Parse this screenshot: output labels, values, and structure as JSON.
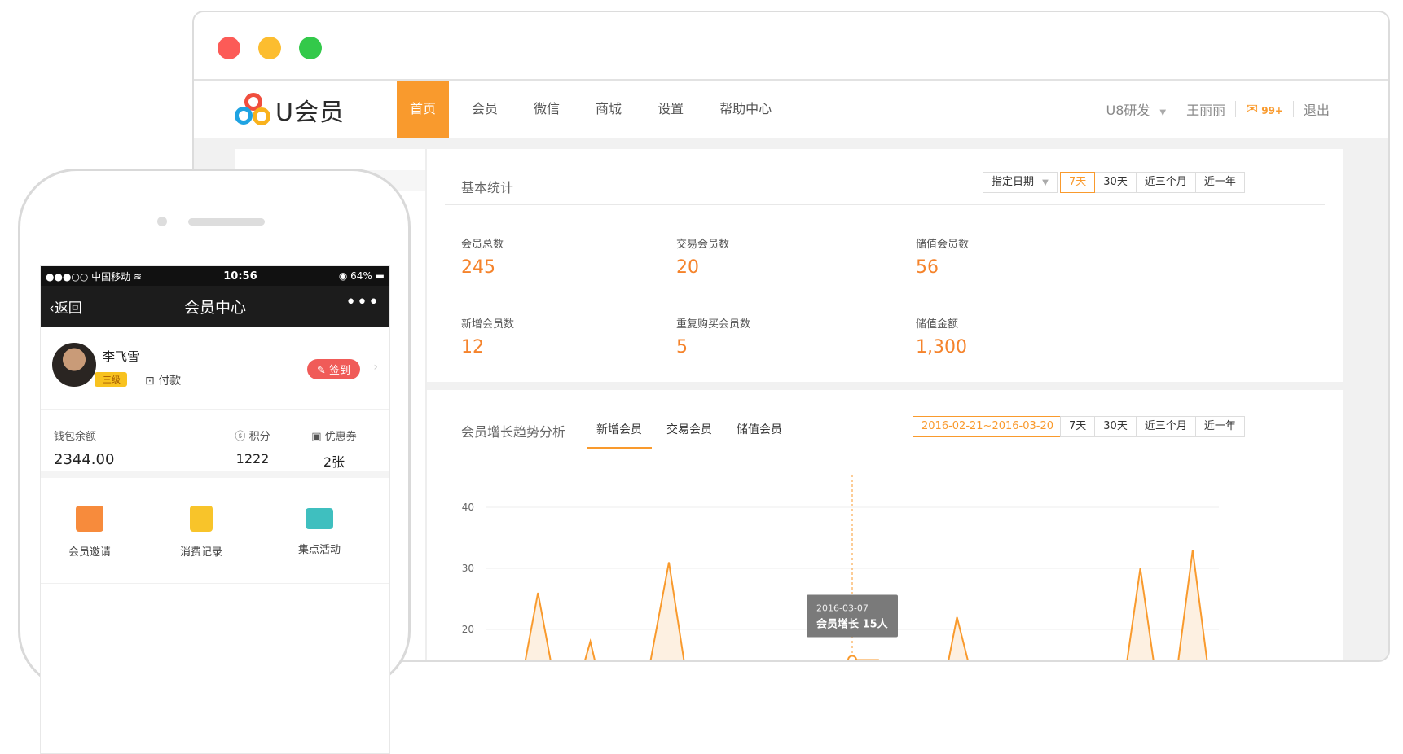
{
  "app": {
    "logo_text": "U会员",
    "nav": [
      "首页",
      "会员",
      "微信",
      "商城",
      "设置",
      "帮助中心"
    ],
    "active_nav": 0,
    "store": "U8研发",
    "user": "王丽丽",
    "message_count": "99+",
    "logout": "退出"
  },
  "stats": {
    "title": "基本统计",
    "date_select": "指定日期",
    "ranges": [
      "7天",
      "30天",
      "近三个月",
      "近一年"
    ],
    "selected_range": 0,
    "items": [
      {
        "label": "会员总数",
        "value": "245"
      },
      {
        "label": "交易会员数",
        "value": "20"
      },
      {
        "label": "储值会员数",
        "value": "56"
      },
      {
        "label": "新增会员数",
        "value": "12"
      },
      {
        "label": "重复购买会员数",
        "value": "5"
      },
      {
        "label": "储值金额",
        "value": "1,300"
      }
    ]
  },
  "trend": {
    "title": "会员增长趋势分析",
    "tabs": [
      "新增会员",
      "交易会员",
      "储值会员"
    ],
    "active_tab": 0,
    "date_range": "2016-02-21~2016-03-20",
    "ranges": [
      "7天",
      "30天",
      "近三个月",
      "近一年"
    ],
    "tooltip_date": "2016-03-07",
    "tooltip_value": "会员增长 15人"
  },
  "chart_data": {
    "type": "area",
    "yticks": [
      20,
      30,
      40
    ],
    "ylim": [
      0,
      40
    ],
    "x": [
      0,
      1,
      2,
      3,
      4,
      5,
      6,
      7,
      8,
      9,
      10,
      11,
      12,
      13,
      14,
      15,
      16,
      17,
      18,
      19,
      20,
      21,
      22,
      23,
      24,
      25,
      26,
      27,
      28
    ],
    "values": [
      0,
      3,
      26,
      3,
      18,
      0,
      8,
      31,
      3,
      0,
      0,
      0,
      0,
      0,
      15,
      15,
      10,
      0,
      22,
      5,
      0,
      0,
      0,
      0,
      0,
      30,
      0,
      33,
      0
    ],
    "highlight_index": 14,
    "color": "#f99a2d",
    "fill": "#fdf0e1"
  },
  "phone": {
    "carrier": "●●●○○ 中国移动",
    "time": "10:56",
    "battery": "64%",
    "back": "返回",
    "title": "会员中心",
    "more": "•••",
    "name": "李飞雪",
    "level": "三级",
    "pay": "付款",
    "signin": "签到",
    "wallet_label": "钱包余额",
    "wallet_value": "2344.00",
    "points_label": "积分",
    "points_value": "1222",
    "coupon_label": "优惠券",
    "coupon_value": "2张",
    "features": [
      "会员邀请",
      "消费记录",
      "集点活动"
    ]
  }
}
